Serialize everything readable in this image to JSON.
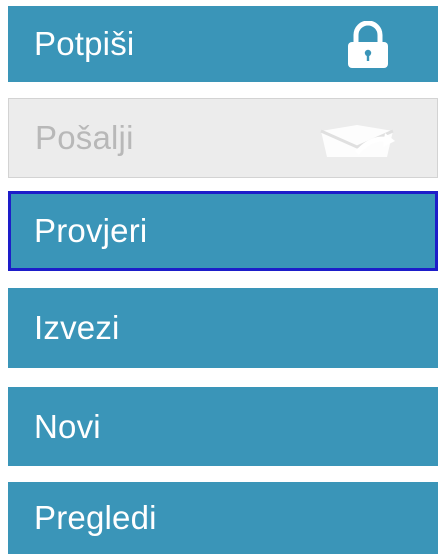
{
  "menu": {
    "buttons": [
      {
        "label": "Potpiši",
        "icon": "lock-icon",
        "state": "enabled"
      },
      {
        "label": "Pošalji",
        "icon": "send-mail-icon",
        "state": "disabled"
      },
      {
        "label": "Provjeri",
        "state": "focused"
      },
      {
        "label": "Izvezi",
        "state": "enabled"
      },
      {
        "label": "Novi",
        "state": "enabled"
      },
      {
        "label": "Pregledi",
        "state": "enabled"
      }
    ]
  },
  "colors": {
    "button_bg": "#3a95b8",
    "button_text": "#ffffff",
    "disabled_bg": "#ececec",
    "disabled_text": "#b8b8b8",
    "focus_border": "#1d1dc9"
  }
}
